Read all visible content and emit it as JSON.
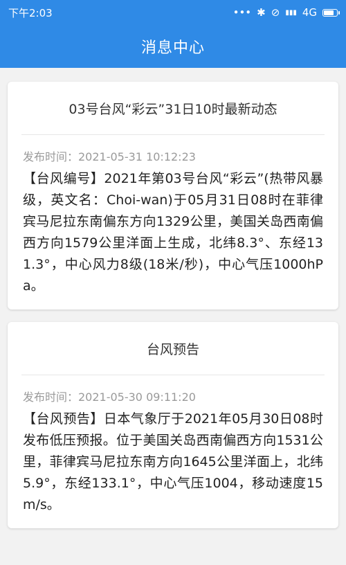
{
  "statusbar": {
    "time": "下午2:03",
    "dots": "•••",
    "bluetooth": "✱",
    "alarm": "⊘",
    "signal": "▮▮▮",
    "network": "4G"
  },
  "appbar": {
    "title": "消息中心"
  },
  "messages": [
    {
      "title": "03号台风“彩云”31日10时最新动态",
      "time": "发布时间：2021-05-31 10:12:23",
      "content": "【台风编号】2021年第03号台风“彩云”(热带风暴级，英文名：Choi-wan)于05月31日08时在菲律宾马尼拉东南偏东方向1329公里，美国关岛西南偏西方向1579公里洋面上生成，北纬8.3°、东经131.3°，中心风力8级(18米/秒)，中心气压1000hPa。"
    },
    {
      "title": "台风预告",
      "time": "发布时间：2021-05-30 09:11:20",
      "content": "【台风预告】日本气象厅于2021年05月30日08时发布低压预报。位于美国关岛西南偏西方向1531公里，菲律宾马尼拉东南方向1645公里洋面上，北纬5.9°，东经133.1°，中心气压1004，移动速度15m/s。"
    }
  ]
}
